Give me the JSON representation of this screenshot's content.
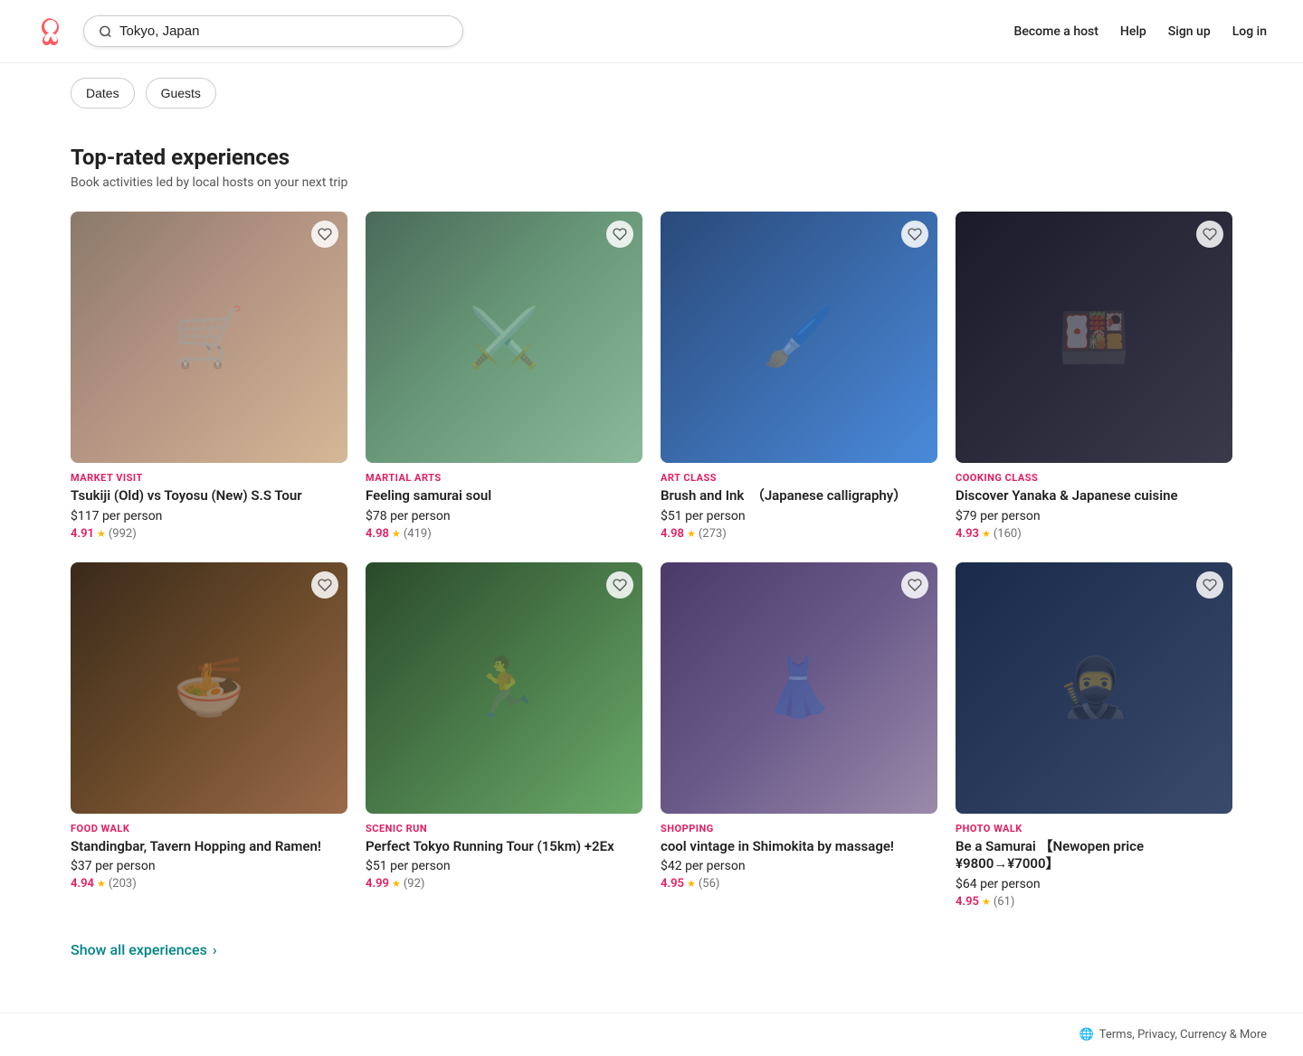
{
  "header": {
    "logo_alt": "Airbnb",
    "search_placeholder": "Tokyo, Japan",
    "search_value": "Tokyo, Japan",
    "nav": {
      "become_host": "Become a host",
      "help": "Help",
      "sign_up": "Sign up",
      "log_in": "Log in"
    }
  },
  "filters": {
    "dates_label": "Dates",
    "guests_label": "Guests"
  },
  "section": {
    "title": "Top-rated experiences",
    "subtitle": "Book activities led by local hosts on your next trip"
  },
  "experiences": [
    {
      "id": 1,
      "img_class": "img-1",
      "category": "MARKET VISIT",
      "title": "Tsukiji (Old) vs Toyosu (New) S.S Tour",
      "price": "$117 per person",
      "rating": "4.91",
      "reviews": "992",
      "emoji": "🛒"
    },
    {
      "id": 2,
      "img_class": "img-2",
      "category": "MARTIAL ARTS",
      "title": "Feeling samurai soul",
      "price": "$78 per person",
      "rating": "4.98",
      "reviews": "419",
      "emoji": "⚔️"
    },
    {
      "id": 3,
      "img_class": "img-3",
      "category": "ART CLASS",
      "title": "Brush and Ink　（Japanese calligraphy）",
      "price": "$51 per person",
      "rating": "4.98",
      "reviews": "273",
      "emoji": "🖌️"
    },
    {
      "id": 4,
      "img_class": "img-4",
      "category": "COOKING CLASS",
      "title": "Discover Yanaka & Japanese cuisine",
      "price": "$79 per person",
      "rating": "4.93",
      "reviews": "160",
      "emoji": "🍱"
    },
    {
      "id": 5,
      "img_class": "img-5",
      "category": "FOOD WALK",
      "title": "Standingbar, Tavern Hopping and Ramen!",
      "price": "$37 per person",
      "rating": "4.94",
      "reviews": "203",
      "emoji": "🍜"
    },
    {
      "id": 6,
      "img_class": "img-6",
      "category": "SCENIC RUN",
      "title": "Perfect Tokyo Running Tour (15km) +2Ex",
      "price": "$51 per person",
      "rating": "4.99",
      "reviews": "92",
      "emoji": "🏃"
    },
    {
      "id": 7,
      "img_class": "img-7",
      "category": "SHOPPING",
      "title": "cool vintage in Shimokita by massage!",
      "price": "$42 per person",
      "rating": "4.95",
      "reviews": "56",
      "emoji": "👗"
    },
    {
      "id": 8,
      "img_class": "img-8",
      "category": "PHOTO WALK",
      "title": "Be a Samurai 【Newopen price ¥9800→¥7000】",
      "price": "$64 per person",
      "rating": "4.95",
      "reviews": "61",
      "emoji": "🥷"
    }
  ],
  "show_all": {
    "label": "Show all experiences",
    "arrow": "›"
  },
  "footer": {
    "globe_icon": "🌐",
    "links": "Terms, Privacy, Currency & More"
  }
}
